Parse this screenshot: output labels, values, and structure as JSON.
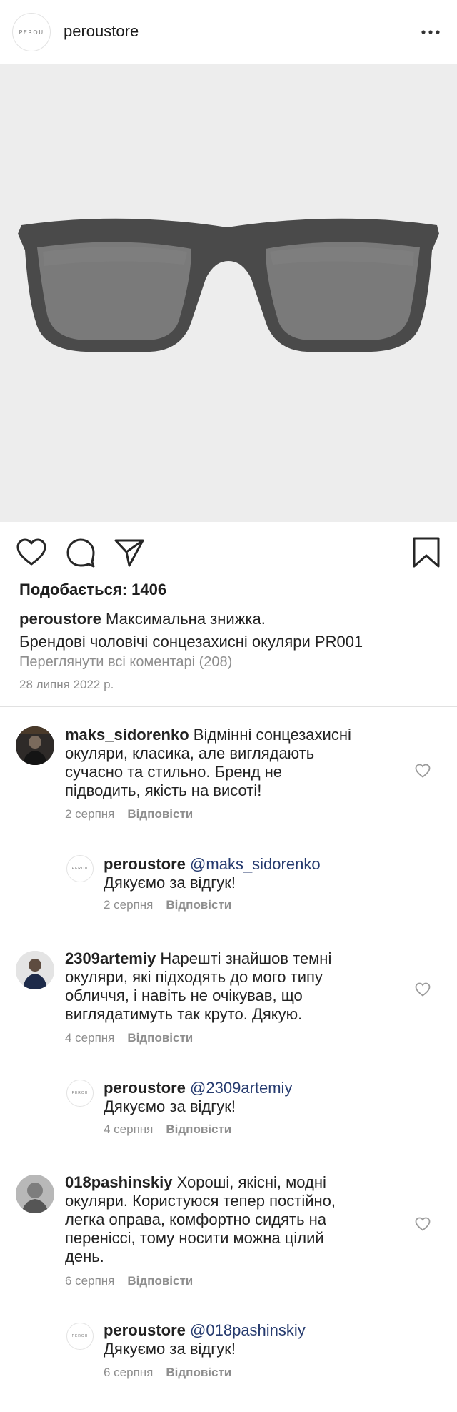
{
  "header": {
    "logo_text": "PEROU",
    "username": "peroustore",
    "more_label": "•••"
  },
  "post": {
    "image_alt": "Sunglasses",
    "likes_label": "Подобається: 1406",
    "caption_user": "peroustore",
    "caption_line1": "Максимальна знижка.",
    "caption_line2": "Брендові чоловічі сонцезахисні окуляри PR001",
    "view_all": "Переглянути всі коментарі (208)",
    "date": "28 липня 2022 р."
  },
  "comments": [
    {
      "user": "maks_sidorenko",
      "lines": [
        "Відмінні сонцезахисні",
        "окуляри, класика, але виглядають",
        "сучасно та стильно. Бренд не",
        "підводить, якість на висоті!"
      ],
      "date": "2 серпня",
      "reply_label": "Відповісти",
      "reply": {
        "user": "peroustore",
        "mention": "@maks_sidorenko",
        "text": "Дякуємо за відгук!",
        "date": "2 серпня",
        "reply_label": "Відповісти"
      }
    },
    {
      "user": "2309artemiy",
      "lines": [
        "Нарешті знайшов темні",
        "окуляри, які підходять до мого типу",
        "обличчя, і навіть не очікував, що",
        "виглядатимуть так круто. Дякую."
      ],
      "date": "4 серпня",
      "reply_label": "Відповісти",
      "reply": {
        "user": "peroustore",
        "mention": "@2309artemiy",
        "text": "Дякуємо за відгук!",
        "date": "4 серпня",
        "reply_label": "Відповісти"
      }
    },
    {
      "user": "018pashinskiy",
      "lines": [
        "Хороші, якісні, модні",
        "окуляри. Користуюся тепер постійно,",
        "легка оправа, комфортно сидять на",
        "переніссі, тому носити можна цілий",
        "день."
      ],
      "date": "6 серпня",
      "reply_label": "Відповісти",
      "reply": {
        "user": "peroustore",
        "mention": "@018pashinskiy",
        "text": "Дякуємо за відгук!",
        "date": "6 серпня",
        "reply_label": "Відповісти"
      }
    }
  ],
  "icons": {
    "like": "heart-icon",
    "comment": "comment-bubble-icon",
    "share": "paper-plane-icon",
    "save": "bookmark-icon"
  }
}
